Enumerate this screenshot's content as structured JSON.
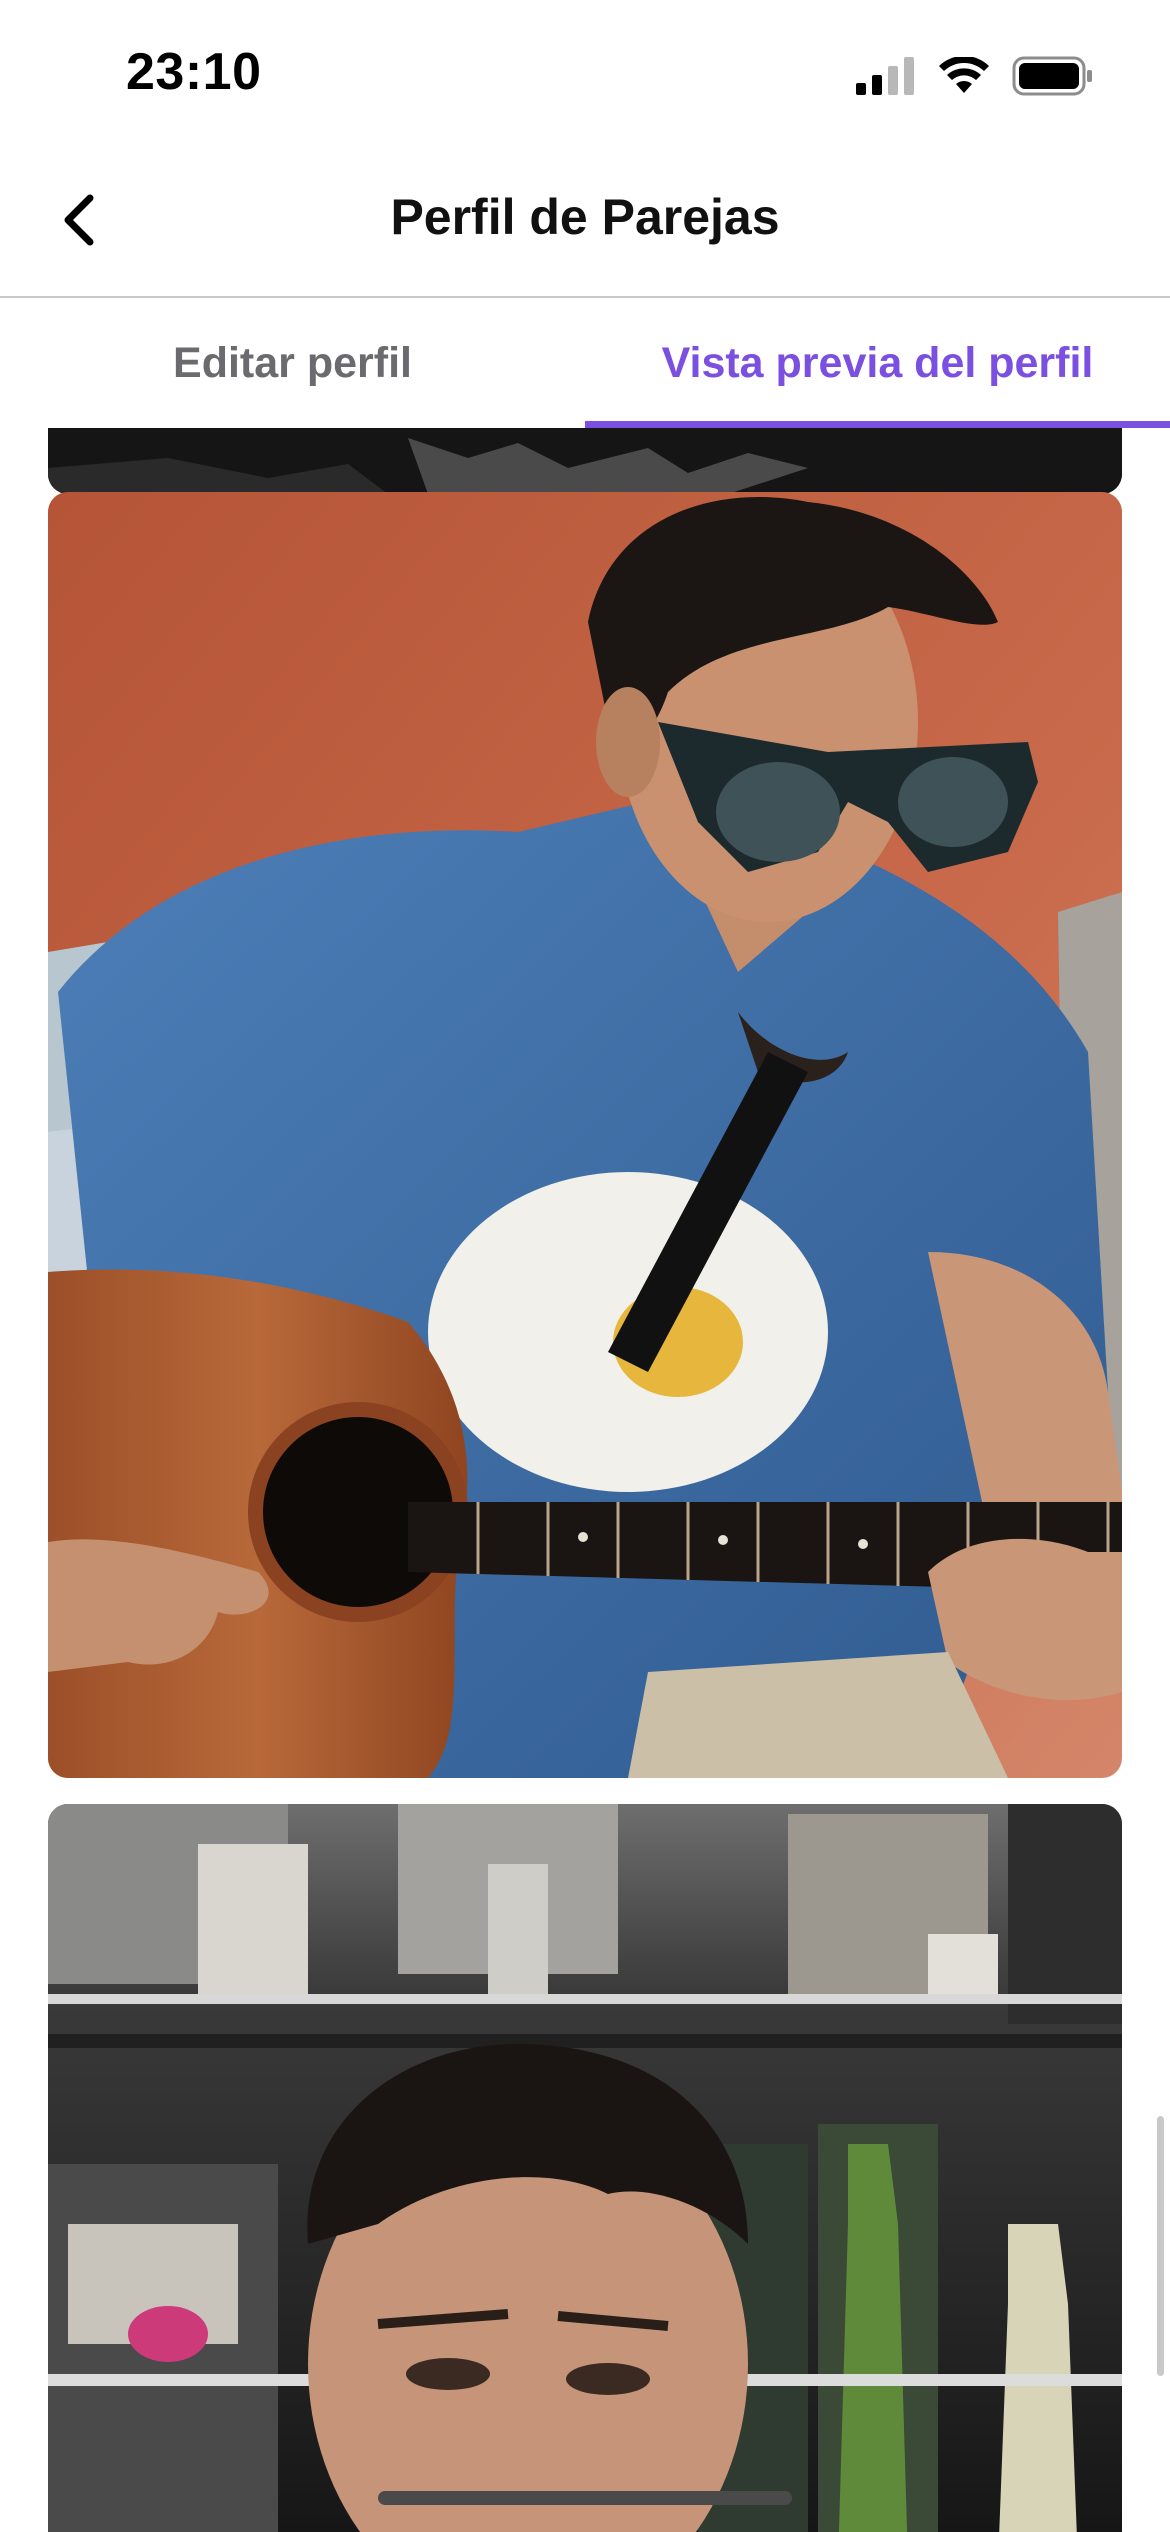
{
  "status_bar": {
    "time": "23:10",
    "signal_icon": "cellular-signal-icon",
    "wifi_icon": "wifi-icon",
    "battery_icon": "battery-icon"
  },
  "nav": {
    "back_icon": "chevron-left-icon",
    "title": "Perfil de Parejas"
  },
  "tabs": [
    {
      "label": "Editar perfil",
      "active": false
    },
    {
      "label": "Vista previa del perfil",
      "active": true
    }
  ],
  "colors": {
    "accent": "#7b4fe0",
    "tab_inactive": "#6b6b6f"
  },
  "photos": [
    {
      "name": "profile-photo-previous",
      "description": "partial photo cut off at top"
    },
    {
      "name": "profile-photo-guitar",
      "description": "man in sunglasses and blue t-shirt playing acoustic guitar"
    },
    {
      "name": "profile-photo-shelves",
      "description": "man in front of shelves with bottles"
    }
  ]
}
